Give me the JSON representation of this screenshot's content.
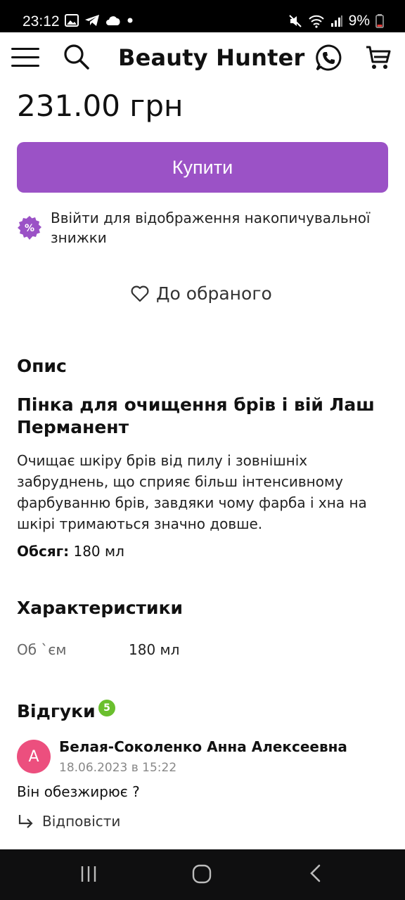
{
  "status_bar": {
    "time": "23:12",
    "battery": "9%",
    "icons": [
      "gallery-icon",
      "telegram-icon",
      "cloud-icon",
      "dot-icon",
      "mute-icon",
      "wifi-icon",
      "signal-icon",
      "battery-icon"
    ]
  },
  "header": {
    "title": "Beauty Hunter",
    "icons": [
      "menu-icon",
      "search-icon",
      "phone-icon",
      "cart-icon"
    ]
  },
  "product": {
    "price": "231.00 грн",
    "buy_label": "Купити",
    "discount_link": "Ввійти",
    "discount_text": " для відображення накопичувальної знижки",
    "discount_badge": "%",
    "favorite_label": "До обраного"
  },
  "description": {
    "heading": "Опис",
    "title": "Пінка для очищення брів і вій Лаш Перманент",
    "text": "Очищає шкіру брів від пилу і зовнішніх забруднень, що сприяє більш інтенсивному фарбуванню брів, завдяки чому фарба і хна на шкірі тримаються значно довше.",
    "volume_label": "Обсяг:",
    "volume_value": " 180 мл"
  },
  "characteristics": {
    "heading": "Характеристики",
    "rows": [
      {
        "key": "Об `єм",
        "value": "180 мл"
      }
    ]
  },
  "reviews": {
    "heading": "Відгуки",
    "count": "5",
    "items": [
      {
        "avatar_letter": "А",
        "author": "Белая-Соколенко Анна Алексеевна",
        "date": "18.06.2023 в 15:22",
        "text": "Він обезжирює ?",
        "reply_label": "Відповісти"
      }
    ]
  },
  "colors": {
    "accent": "#9b52c6",
    "badge_green": "#6abf2e",
    "avatar_pink": "#ec4f7e"
  }
}
